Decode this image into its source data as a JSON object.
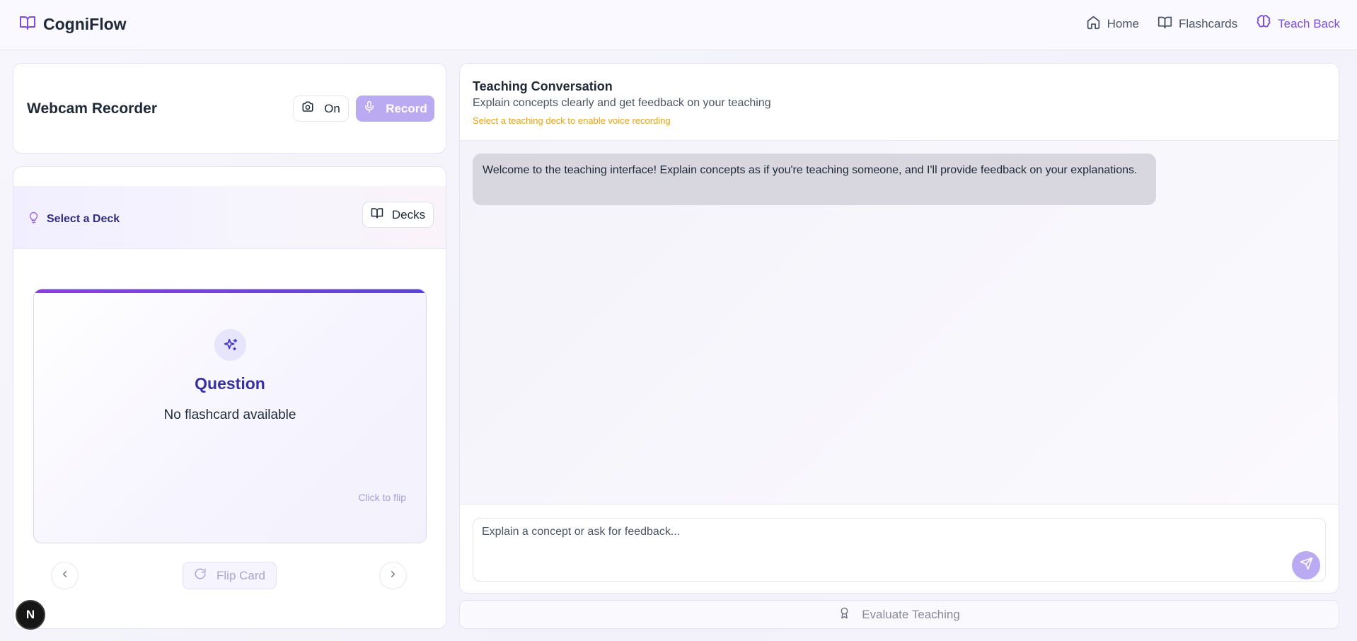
{
  "header": {
    "brand": "CogniFlow",
    "nav": [
      {
        "label": "Home",
        "icon": "home-icon"
      },
      {
        "label": "Flashcards",
        "icon": "book-icon"
      },
      {
        "label": "Teach Back",
        "icon": "brain-icon",
        "active": true
      }
    ]
  },
  "webcam": {
    "title": "Webcam Recorder",
    "camera_label": "On",
    "record_label": "Record"
  },
  "deck": {
    "select_label": "Select a Deck",
    "decks_label": "Decks",
    "card_title": "Question",
    "card_text": "No flashcard available",
    "click_hint": "Click to flip",
    "flip_label": "Flip Card"
  },
  "conversation": {
    "title": "Teaching Conversation",
    "subtitle": "Explain concepts clearly and get feedback on your teaching",
    "warning": "Select a teaching deck to enable voice recording",
    "messages": [
      {
        "role": "assistant",
        "text": "Welcome to the teaching interface! Explain concepts as if you're teaching someone, and I'll provide feedback on your explanations."
      }
    ],
    "input_placeholder": "Explain a concept or ask for feedback..."
  },
  "evaluate_label": "Evaluate Teaching",
  "badge_letter": "N",
  "colors": {
    "accent": "#7c4dde",
    "record_button": "#b9aaf2",
    "warning": "#e5a414",
    "card_title": "#3730a3"
  }
}
